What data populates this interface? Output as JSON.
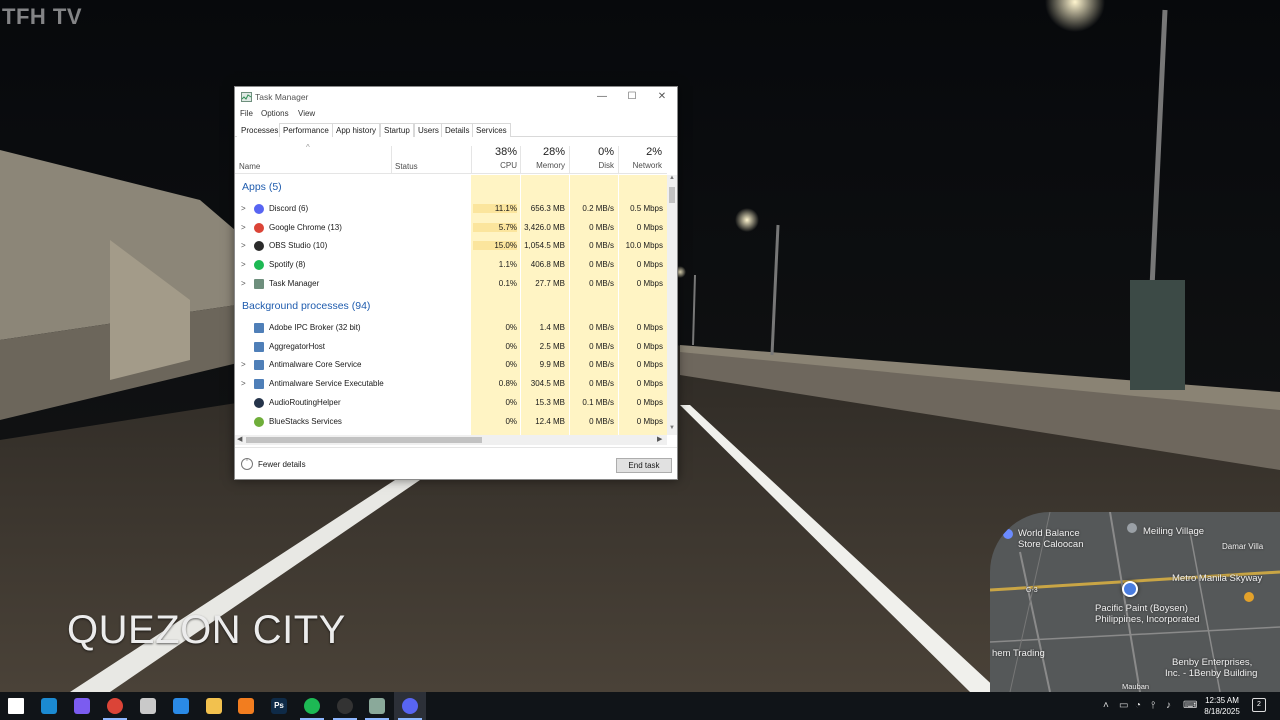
{
  "overlay": {
    "watermark": "TFH TV",
    "city_caption": "QUEZON CITY"
  },
  "minimap": {
    "labels": [
      "World Balance",
      "Store Caloocan",
      "Meiling Village",
      "Damar Villa",
      "Metro Manila Skyway",
      "Pacific Paint (Boysen)",
      "Philippines, Incorporated",
      "hem Trading",
      "Benby Enterprises,",
      "Inc. - 1Benby Building",
      "Mauban",
      "G-3"
    ]
  },
  "window": {
    "title": "Task Manager",
    "controls": {
      "minimize": "—",
      "maximize": "☐",
      "close": "✕"
    }
  },
  "menu": [
    "File",
    "Options",
    "View"
  ],
  "tabs": [
    "Processes",
    "Performance",
    "App history",
    "Startup",
    "Users",
    "Details",
    "Services"
  ],
  "columns": {
    "name": "Name",
    "status": "Status",
    "sort_arrow": "^",
    "cpu": {
      "pct": "38%",
      "label": "CPU"
    },
    "memory": {
      "pct": "28%",
      "label": "Memory"
    },
    "disk": {
      "pct": "0%",
      "label": "Disk"
    },
    "network": {
      "pct": "2%",
      "label": "Network"
    }
  },
  "groups": {
    "apps": "Apps (5)",
    "background": "Background processes (94)"
  },
  "apps": [
    {
      "expander": ">",
      "name": "Discord (6)",
      "icon": "discord-icon",
      "cpu": "11.1%",
      "memory": "656.3 MB",
      "disk": "0.2 MB/s",
      "network": "0.5 Mbps"
    },
    {
      "expander": ">",
      "name": "Google Chrome (13)",
      "icon": "chrome-icon",
      "cpu": "5.7%",
      "memory": "3,426.0 MB",
      "disk": "0 MB/s",
      "network": "0 Mbps"
    },
    {
      "expander": ">",
      "name": "OBS Studio (10)",
      "icon": "obs-icon",
      "cpu": "15.0%",
      "memory": "1,054.5 MB",
      "disk": "0 MB/s",
      "network": "10.0 Mbps"
    },
    {
      "expander": ">",
      "name": "Spotify (8)",
      "icon": "spotify-icon",
      "cpu": "1.1%",
      "memory": "406.8 MB",
      "disk": "0 MB/s",
      "network": "0 Mbps"
    },
    {
      "expander": ">",
      "name": "Task Manager",
      "icon": "task-manager-icon",
      "cpu": "0.1%",
      "memory": "27.7 MB",
      "disk": "0 MB/s",
      "network": "0 Mbps"
    }
  ],
  "background": [
    {
      "expander": "",
      "name": "Adobe IPC Broker (32 bit)",
      "icon": "app-window-icon",
      "cpu": "0%",
      "memory": "1.4 MB",
      "disk": "0 MB/s",
      "network": "0 Mbps"
    },
    {
      "expander": "",
      "name": "AggregatorHost",
      "icon": "app-window-icon",
      "cpu": "0%",
      "memory": "2.5 MB",
      "disk": "0 MB/s",
      "network": "0 Mbps"
    },
    {
      "expander": ">",
      "name": "Antimalware Core Service",
      "icon": "app-window-icon",
      "cpu": "0%",
      "memory": "9.9 MB",
      "disk": "0 MB/s",
      "network": "0 Mbps"
    },
    {
      "expander": ">",
      "name": "Antimalware Service Executable",
      "icon": "app-window-icon",
      "cpu": "0.8%",
      "memory": "304.5 MB",
      "disk": "0 MB/s",
      "network": "0 Mbps"
    },
    {
      "expander": "",
      "name": "AudioRoutingHelper",
      "icon": "audio-helper-icon",
      "cpu": "0%",
      "memory": "15.3 MB",
      "disk": "0.1 MB/s",
      "network": "0 Mbps"
    },
    {
      "expander": "",
      "name": "BlueStacks Services",
      "icon": "bluestacks-icon",
      "cpu": "0%",
      "memory": "12.4 MB",
      "disk": "0 MB/s",
      "network": "0 Mbps"
    }
  ],
  "footer": {
    "fewer_details": "Fewer details",
    "end_task": "End task"
  },
  "taskbar": {
    "pinned": [
      "start-icon",
      "edge-icon",
      "copilot-icon",
      "chrome-icon",
      "chrome-profile-icon",
      "vscode-icon",
      "file-explorer-icon",
      "sublime-icon",
      "photoshop-icon",
      "spotify-icon",
      "obs-icon",
      "task-manager-icon",
      "discord-icon"
    ],
    "photoshop_label": "Ps",
    "time": "12:35 AM",
    "date": "8/18/2025",
    "notification_count": "2"
  },
  "colors": {
    "group_header": "#1f5cae",
    "cpu_heat": "#fff4c4",
    "cpu_hot": "#fbe59d",
    "taskbar": "#101418"
  }
}
